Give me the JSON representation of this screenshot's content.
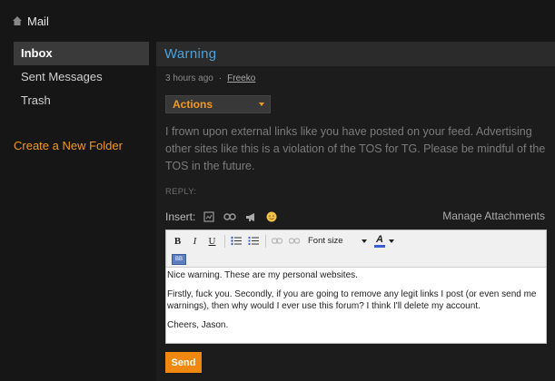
{
  "app": {
    "title": "Mail",
    "icon": "home-icon"
  },
  "sidebar": {
    "items": [
      {
        "label": "Inbox",
        "active": true
      },
      {
        "label": "Sent Messages",
        "active": false
      },
      {
        "label": "Trash",
        "active": false
      }
    ],
    "new_folder": "Create a New Folder"
  },
  "message": {
    "title": "Warning",
    "time": "3 hours ago",
    "separator": "·",
    "author": "Freeko",
    "actions_label": "Actions",
    "body": "I frown upon external links like you have posted on your feed. Advertising other sites like this is a violation of the TOS for TG. Please be mindful of the TOS in the future."
  },
  "reply": {
    "label": "REPLY:",
    "insert_label": "Insert:",
    "insert_icons": [
      "image-icon",
      "link-icon",
      "megaphone-icon",
      "smiley-icon"
    ],
    "manage_attachments": "Manage Attachments",
    "toolbar": {
      "bold": "B",
      "italic": "I",
      "underline": "U",
      "font_size": "Font size",
      "text_color": "A",
      "bbcode": "BB"
    },
    "content": [
      "Nice warning.  These are my personal websites.",
      "Firstly, fuck you.  Secondly, if you are going to remove any legit links I post (or even send me warnings), then why would I ever use this forum?  I think I'll delete my account.",
      "Cheers, Jason."
    ],
    "send_label": "Send"
  },
  "colors": {
    "accent": "#f39a1e",
    "title_blue": "#4aa3df",
    "send_bg": "#f0880f",
    "background": "#161616"
  }
}
